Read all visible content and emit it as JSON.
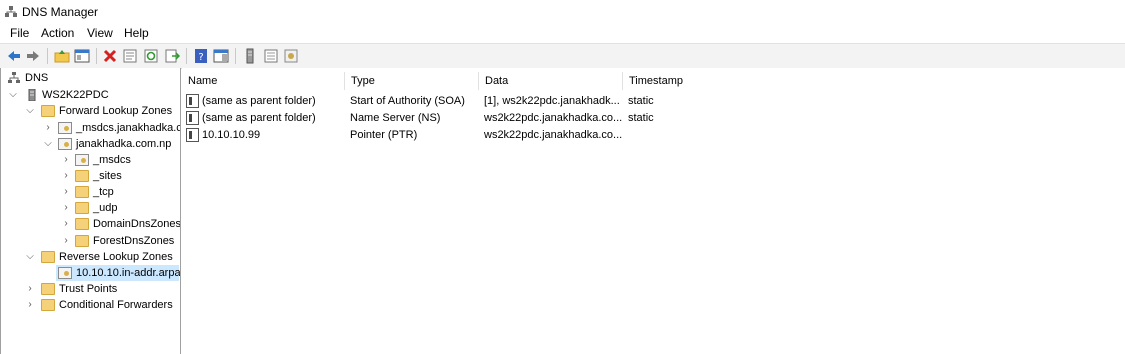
{
  "window": {
    "title": "DNS Manager",
    "icon": "dns-manager-icon"
  },
  "menu": [
    "File",
    "Action",
    "View",
    "Help"
  ],
  "toolbar": {
    "buttons": [
      "back-arrow-icon",
      "forward-arrow-icon",
      "up-folder-icon",
      "show-hide-tree-icon",
      "delete-icon",
      "properties-icon",
      "refresh-icon",
      "export-list-icon",
      "help-icon",
      "action-pane-icon",
      "server-icon",
      "list-icon",
      "zone-icon"
    ]
  },
  "tree": {
    "items": [
      {
        "label": "DNS",
        "icon": "dns-icon",
        "expander": ""
      },
      {
        "label": "WS2K22PDC",
        "icon": "server-icon",
        "expander": "expanded"
      },
      {
        "label": "Forward Lookup Zones",
        "icon": "folder-icon",
        "expander": "expanded"
      },
      {
        "label": "_msdcs.janakhadka.c",
        "icon": "zone-icon",
        "expander": "collapsed"
      },
      {
        "label": "janakhadka.com.np",
        "icon": "zone-icon",
        "expander": "expanded"
      },
      {
        "label": "_msdcs",
        "icon": "zone-icon",
        "expander": "collapsed"
      },
      {
        "label": "_sites",
        "icon": "folder-icon",
        "expander": "collapsed"
      },
      {
        "label": "_tcp",
        "icon": "folder-icon",
        "expander": "collapsed"
      },
      {
        "label": "_udp",
        "icon": "folder-icon",
        "expander": "collapsed"
      },
      {
        "label": "DomainDnsZones",
        "icon": "folder-icon",
        "expander": "collapsed"
      },
      {
        "label": "ForestDnsZones",
        "icon": "folder-icon",
        "expander": "collapsed"
      },
      {
        "label": "Reverse Lookup Zones",
        "icon": "folder-icon",
        "expander": "expanded"
      },
      {
        "label": "10.10.10.in-addr.arpa",
        "icon": "zone-icon",
        "expander": "",
        "selected": true
      },
      {
        "label": "Trust Points",
        "icon": "folder-icon",
        "expander": "collapsed"
      },
      {
        "label": "Conditional Forwarders",
        "icon": "folder-icon",
        "expander": "collapsed"
      }
    ]
  },
  "list": {
    "columns": [
      "Name",
      "Type",
      "Data",
      "Timestamp"
    ],
    "rows": [
      {
        "name": "(same as parent folder)",
        "type": "Start of Authority (SOA)",
        "data": "[1], ws2k22pdc.janakhadk...",
        "timestamp": "static"
      },
      {
        "name": "(same as parent folder)",
        "type": "Name Server (NS)",
        "data": "ws2k22pdc.janakhadka.co...",
        "timestamp": "static"
      },
      {
        "name": "10.10.10.99",
        "type": "Pointer (PTR)",
        "data": "ws2k22pdc.janakhadka.co...",
        "timestamp": ""
      }
    ]
  }
}
